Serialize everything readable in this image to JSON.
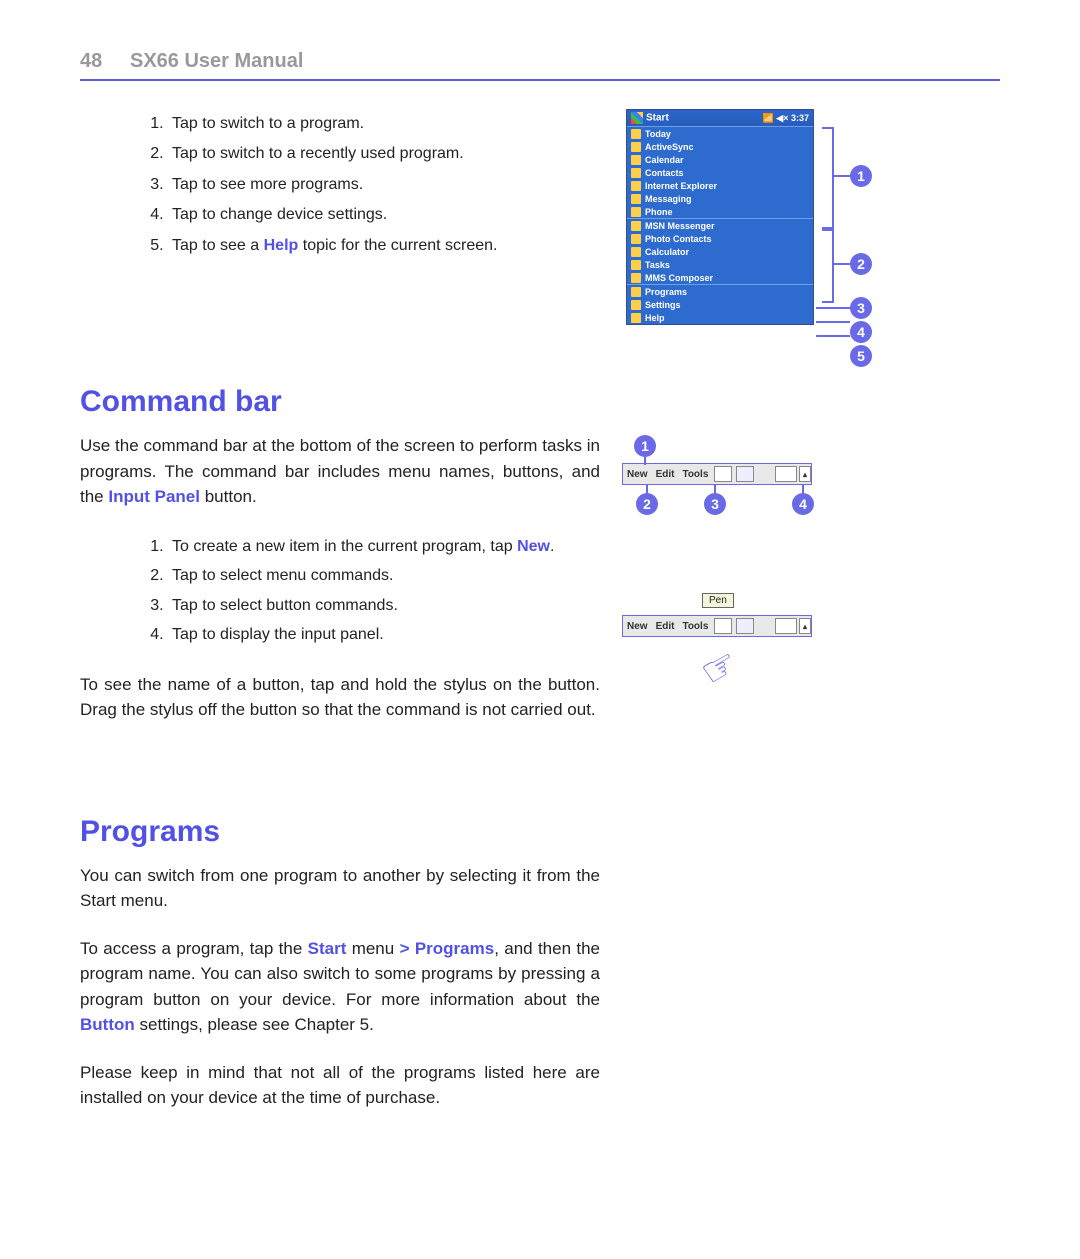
{
  "header": {
    "page_number": "48",
    "title": "SX66 User Manual"
  },
  "list1": {
    "items": [
      "Tap to switch to a program.",
      "Tap to switch to a recently used program.",
      "Tap to see more programs.",
      "Tap to change device settings.",
      {
        "pre": "Tap to see a ",
        "kw": "Help",
        "post": " topic for the current screen."
      }
    ]
  },
  "start_menu": {
    "title": "Start",
    "time": "3:37",
    "group1": [
      "Today",
      "ActiveSync",
      "Calendar",
      "Contacts",
      "Internet Explorer",
      "Messaging",
      "Phone"
    ],
    "group2": [
      "MSN Messenger",
      "Photo Contacts",
      "Calculator",
      "Tasks",
      "MMS Composer"
    ],
    "group3": [
      "Programs",
      "Settings",
      "Help"
    ],
    "callouts": [
      "1",
      "2",
      "3",
      "4",
      "5"
    ]
  },
  "section_cmd": {
    "heading": "Command bar",
    "para1_pre": "Use the command bar at the bottom of the screen to perform tasks in programs. The command bar includes menu names, buttons, and the ",
    "para1_kw": "Input Panel",
    "para1_post": " button.",
    "list": [
      {
        "pre": "To create a new item in the current program, tap ",
        "kw": "New",
        "post": "."
      },
      "Tap to select menu commands.",
      "Tap to select button commands.",
      "Tap to display the input panel."
    ],
    "para2": "To see the name of a button, tap and hold the stylus on the button. Drag the stylus off the button so that the command is not carried out."
  },
  "cmdbar": {
    "items": [
      "New",
      "Edit",
      "Tools"
    ],
    "callouts": [
      "1",
      "2",
      "3",
      "4"
    ],
    "tooltip": "Pen"
  },
  "section_prog": {
    "heading": "Programs",
    "para1": "You can switch from one program to another by selecting it from the Start menu.",
    "para2_a": "To access a program, tap the ",
    "para2_kw1": "Start",
    "para2_b": " menu ",
    "para2_kw2": "> Programs",
    "para2_c": ", and then the program name. You can also switch to some programs by pressing a program button on your device. For more information about the ",
    "para2_kw3": "Button",
    "para2_d": " settings, please see Chapter 5.",
    "para3": "Please keep in mind that not all of the programs listed here are installed on your device at the time of purchase."
  }
}
